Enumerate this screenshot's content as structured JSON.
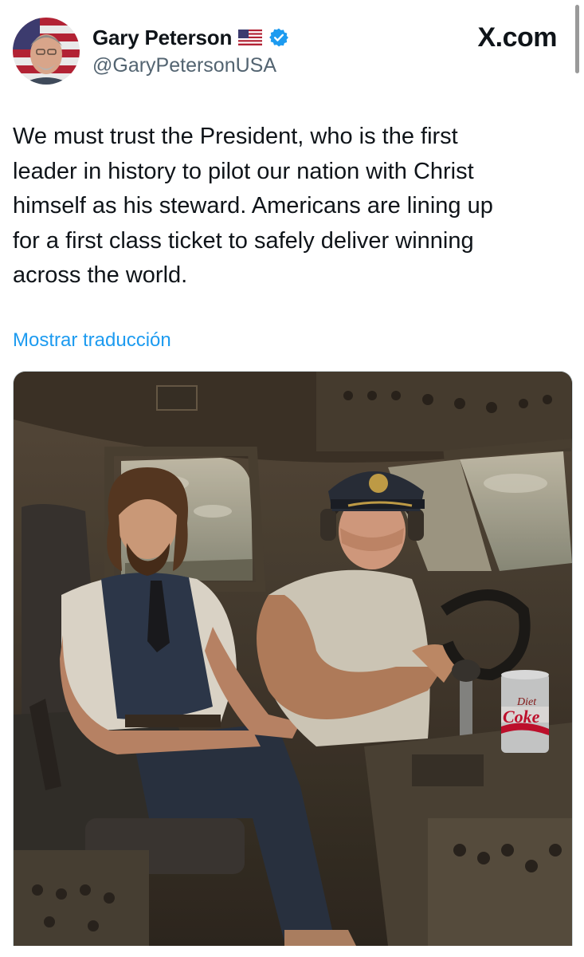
{
  "post": {
    "author": {
      "display_name": "Gary Peterson",
      "handle": "@GaryPetersonUSA",
      "flag": "us-flag-emoji",
      "verified": true
    },
    "site": "X.com",
    "text": "We must trust the President, who is the first\nleader in history to pilot our nation with Christ\nhimself as his steward.  Americans are lining up\nfor a first class ticket to safely deliver winning\nacross the world.",
    "translate_link": "Mostrar traducción",
    "image": {
      "can_label_line1": "Diet",
      "can_label_line2": "Coke"
    }
  },
  "colors": {
    "text_primary": "#0f1419",
    "text_secondary": "#536471",
    "link": "#1d9bf0",
    "verified_badge": "#1d9bf0"
  }
}
